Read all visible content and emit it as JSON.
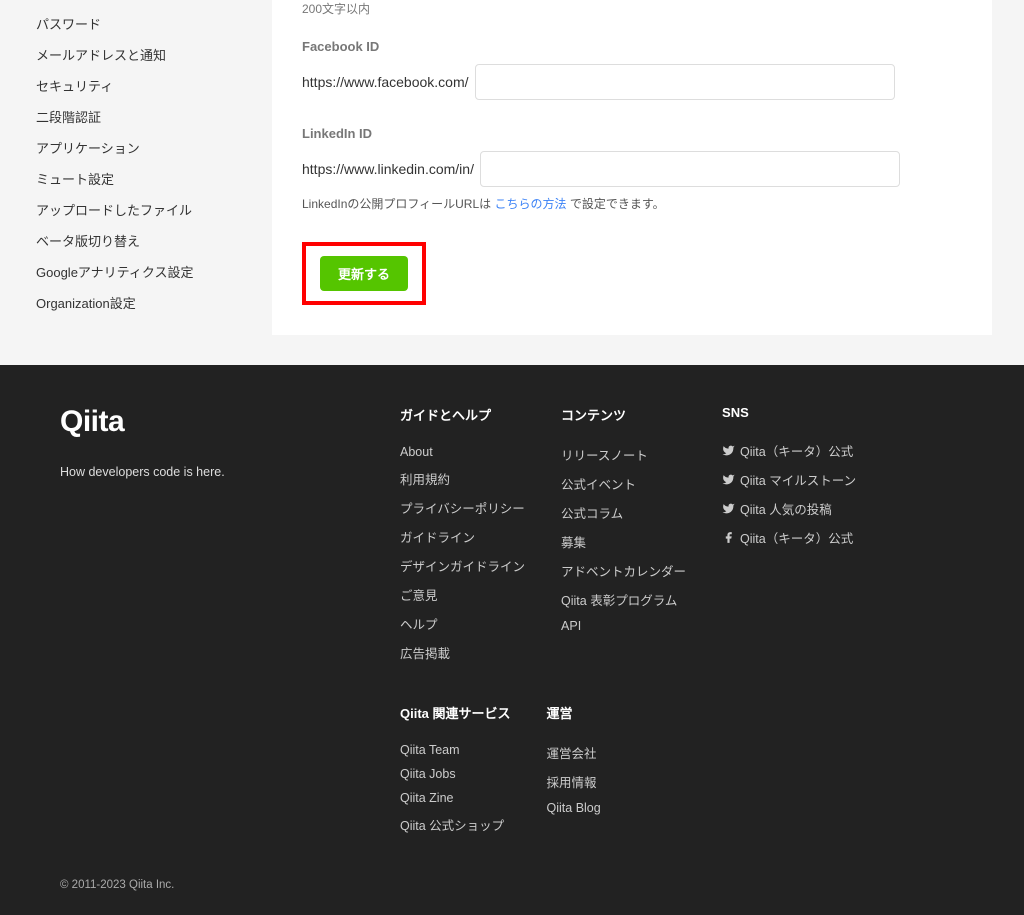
{
  "sidebar": {
    "items": [
      {
        "label": "パスワード"
      },
      {
        "label": "メールアドレスと通知"
      },
      {
        "label": "セキュリティ"
      },
      {
        "label": "二段階認証"
      },
      {
        "label": "アプリケーション"
      },
      {
        "label": "ミュート設定"
      },
      {
        "label": "アップロードしたファイル"
      },
      {
        "label": "ベータ版切り替え"
      },
      {
        "label": "Googleアナリティクス設定"
      },
      {
        "label": "Organization設定"
      }
    ]
  },
  "form": {
    "char_limit_note": "200文字以内",
    "facebook": {
      "label": "Facebook ID",
      "prefix": "https://www.facebook.com/"
    },
    "linkedin": {
      "label": "LinkedIn ID",
      "prefix": "https://www.linkedin.com/in/",
      "note_before": "LinkedInの公開プロフィールURLは ",
      "note_link": "こちらの方法",
      "note_after": " で設定できます。"
    },
    "submit_label": "更新する"
  },
  "footer": {
    "logo": "Qiita",
    "tagline": "How developers code is here.",
    "copyright": "© 2011-2023 Qiita Inc.",
    "columns": [
      {
        "heading": "ガイドとヘルプ",
        "links": [
          {
            "label": "About"
          },
          {
            "label": "利用規約"
          },
          {
            "label": "プライバシーポリシー"
          },
          {
            "label": "ガイドライン"
          },
          {
            "label": "デザインガイドライン"
          },
          {
            "label": "ご意見"
          },
          {
            "label": "ヘルプ"
          },
          {
            "label": "広告掲載"
          }
        ]
      },
      {
        "heading": "コンテンツ",
        "links": [
          {
            "label": "リリースノート"
          },
          {
            "label": "公式イベント"
          },
          {
            "label": "公式コラム"
          },
          {
            "label": "募集"
          },
          {
            "label": "アドベントカレンダー"
          },
          {
            "label": "Qiita 表彰プログラム"
          },
          {
            "label": "API"
          }
        ]
      },
      {
        "heading": "SNS",
        "links": [
          {
            "icon": "twitter",
            "label": "Qiita（キータ）公式"
          },
          {
            "icon": "twitter",
            "label": "Qiita マイルストーン"
          },
          {
            "icon": "twitter",
            "label": "Qiita 人気の投稿"
          },
          {
            "icon": "facebook",
            "label": "Qiita（キータ）公式"
          }
        ]
      },
      {
        "heading": "Qiita 関連サービス",
        "links": [
          {
            "label": "Qiita Team"
          },
          {
            "label": "Qiita Jobs"
          },
          {
            "label": "Qiita Zine"
          },
          {
            "label": "Qiita 公式ショップ"
          }
        ]
      },
      {
        "heading": "運営",
        "links": [
          {
            "label": "運営会社"
          },
          {
            "label": "採用情報"
          },
          {
            "label": "Qiita Blog"
          }
        ]
      }
    ]
  }
}
